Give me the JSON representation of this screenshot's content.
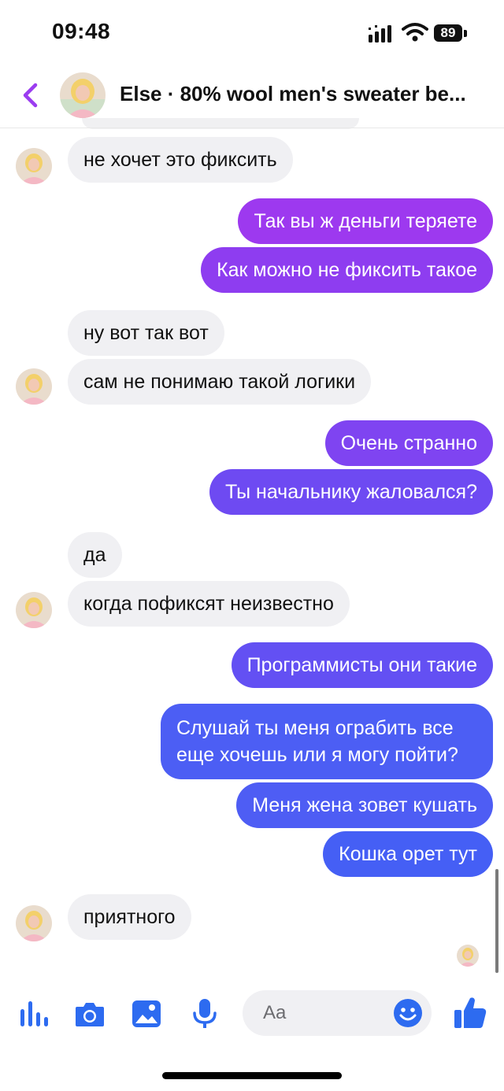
{
  "status_bar": {
    "time": "09:48",
    "battery": "89"
  },
  "header": {
    "title": "Else · 80% wool men's sweater be..."
  },
  "messages": [
    {
      "dir": "in",
      "text": "не хочет это фиксить"
    },
    {
      "dir": "out",
      "text": "Так вы ж деньги теряете"
    },
    {
      "dir": "out",
      "text": "Как можно не фиксить такое"
    },
    {
      "dir": "in",
      "text": "ну вот так вот"
    },
    {
      "dir": "in",
      "text": "сам не понимаю такой логики"
    },
    {
      "dir": "out",
      "text": "Очень странно"
    },
    {
      "dir": "out",
      "text": "Ты начальнику жаловался?"
    },
    {
      "dir": "in",
      "text": "да"
    },
    {
      "dir": "in",
      "text": "когда пофиксят неизвестно"
    },
    {
      "dir": "out",
      "text": "Программисты они такие"
    },
    {
      "dir": "out",
      "text": "Слушай ты меня ограбить все еще хочешь или я могу пойти?"
    },
    {
      "dir": "out",
      "text": "Меня жена зовет кушать"
    },
    {
      "dir": "out",
      "text": "Кошка орет тут"
    },
    {
      "dir": "in",
      "text": "приятного"
    }
  ],
  "composer": {
    "placeholder": "Aa"
  },
  "icons": {
    "back": "chevron-left-icon",
    "toolbar": [
      "audio-bars-icon",
      "camera-icon",
      "image-icon",
      "microphone-icon",
      "emoji-icon",
      "thumbs-up-icon"
    ],
    "status": [
      "signal-icon",
      "wifi-icon",
      "battery-icon"
    ]
  },
  "colors": {
    "accent": "#9B3CF0",
    "outgoing_top": "#9B3AF0",
    "outgoing_bottom": "#3B63F5",
    "incoming": "#F0F0F3",
    "toolbar_blue": "#2D6BF0"
  }
}
